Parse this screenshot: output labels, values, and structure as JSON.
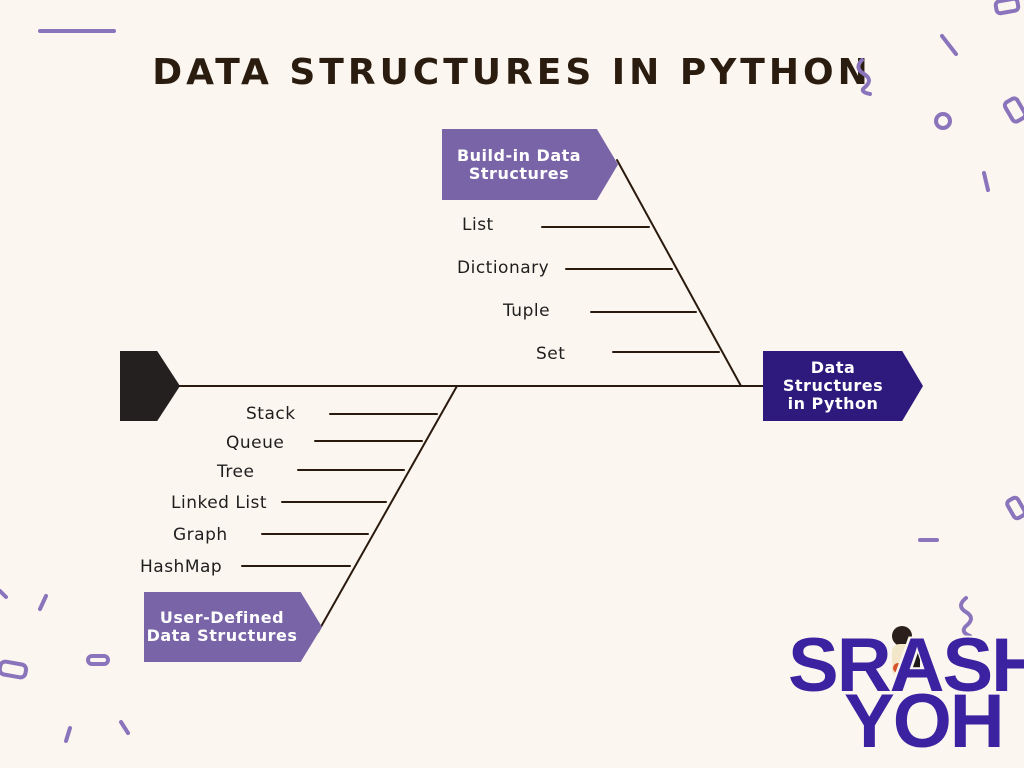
{
  "title": "DATA STRUCTURES IN PYTHON",
  "head": "Data\nStructures\nin Python",
  "builtin": {
    "heading": "Build-in Data\nStructures",
    "items": [
      "List",
      "Dictionary",
      "Tuple",
      "Set"
    ]
  },
  "user_defined": {
    "heading": "User-Defined\nData Structures",
    "items": [
      "Stack",
      "Queue",
      "Tree",
      "Linked List",
      "Graph",
      "HashMap"
    ]
  },
  "logo": {
    "line1": "SRASH",
    "line2": "YOH"
  },
  "colors": {
    "accent_purple": "#7a64a8",
    "head_indigo": "#2d1a7c",
    "tail_dark": "#242020",
    "title_brown": "#2b1c10",
    "background": "#fcf6f0",
    "logo_blue": "#3a22a0",
    "decor_lavender": "#8a74bc"
  },
  "icons": {
    "title_decoration": "squiggle-icon",
    "background_decoration": "confetti-icon"
  }
}
